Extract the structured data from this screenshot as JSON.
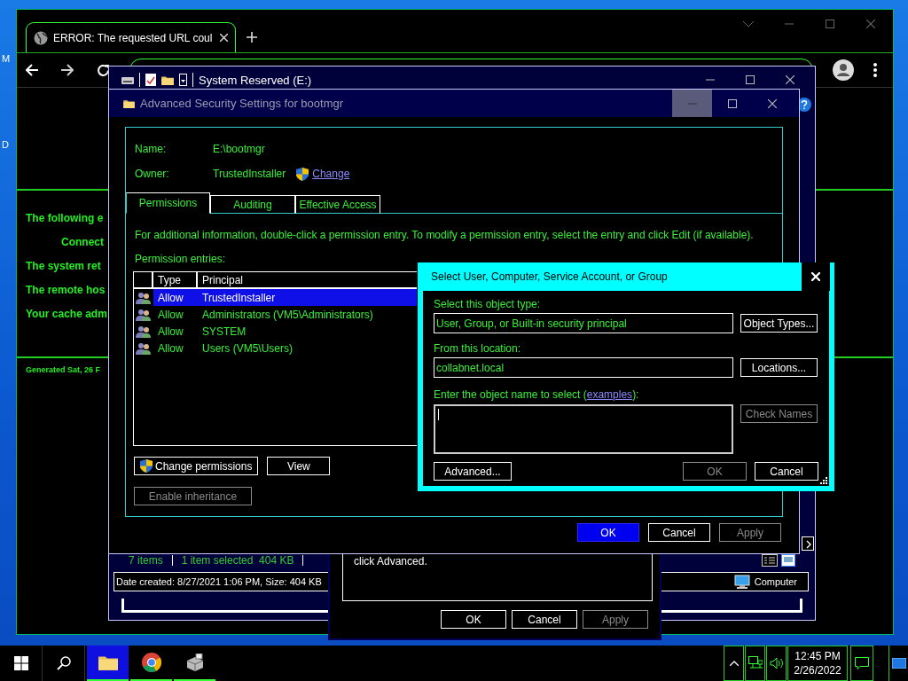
{
  "desktop": {
    "icon_labels": [
      "M",
      "D"
    ]
  },
  "browser": {
    "tab_title": "ERROR: The requested URL coul",
    "page_lines": [
      {
        "text": "The following e",
        "kind": "text"
      },
      {
        "text": "Connect",
        "kind": "heading"
      },
      {
        "text": "The system ret",
        "kind": "text"
      },
      {
        "text": "The remote hos",
        "kind": "text"
      },
      {
        "text": "Your cache adm",
        "kind": "text"
      }
    ],
    "footer": "Generated Sat, 26 F"
  },
  "explorer": {
    "title": "System Reserved (E:)",
    "item_count": "7 items",
    "selection": "1 item selected  404 KB",
    "details": "Date created: 8/27/2021 1:06 PM, Size: 404 KB",
    "location": "Computer"
  },
  "properties_dialog": {
    "text": "click Advanced.",
    "buttons": [
      {
        "label": "OK",
        "disabled": false
      },
      {
        "label": "Cancel",
        "disabled": false
      },
      {
        "label": "Apply",
        "disabled": true
      }
    ]
  },
  "advanced_security": {
    "title": "Advanced Security Settings for bootmgr",
    "name_label": "Name:",
    "name": "E:\\bootmgr",
    "owner_label": "Owner:",
    "owner": "TrustedInstaller",
    "change_link": "Change",
    "tabs": [
      {
        "label": "Permissions",
        "selected": true
      },
      {
        "label": "Auditing",
        "selected": false
      },
      {
        "label": "Effective Access",
        "selected": false
      }
    ],
    "info": "For additional information, double-click a permission entry. To modify a permission entry, select the entry and click Edit (if available).",
    "entries_label": "Permission entries:",
    "columns": [
      "Type",
      "Principal"
    ],
    "entries": [
      {
        "type": "Allow",
        "principal": "TrustedInstaller",
        "selected": true
      },
      {
        "type": "Allow",
        "principal": "Administrators (VM5\\Administrators)",
        "selected": false
      },
      {
        "type": "Allow",
        "principal": "SYSTEM",
        "selected": false
      },
      {
        "type": "Allow",
        "principal": "Users (VM5\\Users)",
        "selected": false
      }
    ],
    "actions": [
      {
        "label": "Change permissions",
        "kind": "shield"
      },
      {
        "label": "View",
        "kind": "plain"
      }
    ],
    "inheritance_button": {
      "label": "Enable inheritance",
      "disabled": true
    },
    "buttons": [
      {
        "label": "OK",
        "default": true,
        "disabled": false
      },
      {
        "label": "Cancel",
        "default": false,
        "disabled": false
      },
      {
        "label": "Apply",
        "default": false,
        "disabled": true
      }
    ]
  },
  "select_dialog": {
    "title": "Select User, Computer, Service Account, or Group",
    "object_type_label": "Select this object type:",
    "object_type": "User, Group, or Built-in security principal",
    "object_types_button": "Object Types...",
    "location_label": "From this location:",
    "location": "collabnet.local",
    "locations_button": "Locations...",
    "name_label_before": "Enter the object name to select (",
    "examples_link": "examples",
    "name_label_after": "):",
    "check_names_button": {
      "label": "Check Names",
      "disabled": true
    },
    "buttons": [
      {
        "label": "Advanced...",
        "disabled": false
      },
      {
        "label": "OK",
        "disabled": true
      },
      {
        "label": "Cancel",
        "disabled": false
      }
    ]
  },
  "taskbar": {
    "apps": [
      {
        "kind": "folder",
        "active": true
      },
      {
        "kind": "browser",
        "active": false
      },
      {
        "kind": "setup",
        "active": false
      }
    ],
    "time": "12:45 PM",
    "date": "2/26/2022"
  }
}
